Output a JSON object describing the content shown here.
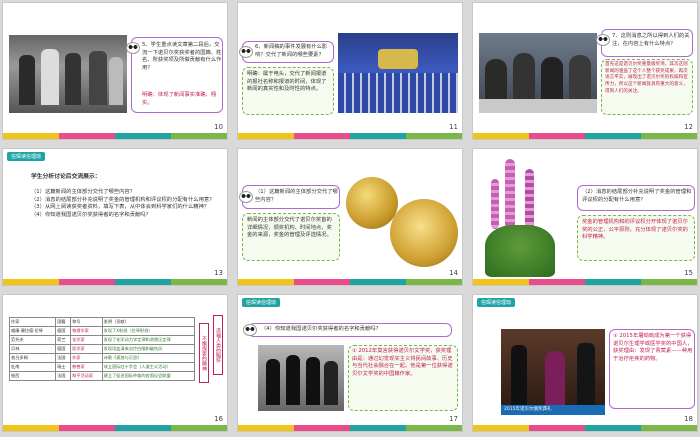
{
  "slides": [
    {
      "num": "10",
      "q": "5、学生重点读文章第二段后，交流一下诺贝尔奖获奖者的国籍、姓名、所获奖项及所做贡献有什么作用？",
      "a": "明确：体现了新闻事实准确、翔实。"
    },
    {
      "num": "11",
      "q": "6、新闻稿的事件发展有什么影响？交代了新闻的哪些要素？",
      "a": "明确：属于电头，交代了新闻报道的报社名称和报道的时间，体现了新闻的真实性和及时性的特点。"
    },
    {
      "num": "12",
      "q": "7、这则消息之所以得到人们的关注，在内容上有什么特点？",
      "a": "首先这是诺贝尔奖重量级奖项，其次这则新闻的涵盖了这个人整个获奖成果，再次语言平实，展现出了诺贝尔奖的权威和宣传力，所以这个新闻就具有重大的意义，得到人们的关注。"
    },
    {
      "num": "13",
      "tag": "信琛读信理琼",
      "title": "学生分析讨论后交流展示：",
      "items": [
        "（1）这篇新闻的主体部分交代了哪些内容？",
        "（2）消息的结尾部分补充说明了奖金的管理机构和评议权的分配有什么用意？",
        "（3）从网上阅读获奖者资料，填写下表，从中体会到科学家们的什么精神？",
        "（4）你知道我国诺贝尔奖获得者的名字和贡献吗？"
      ]
    },
    {
      "num": "14",
      "q": "（1）这篇新闻的主体部分交代了哪些内容？",
      "a": "新闻的主体部分交代了诺贝尔奖首的详细情况，颁奖机构、时间地点，奖金的来源，奖金的管理及评选情况。"
    },
    {
      "num": "15",
      "q": "（2）消息的结尾部分补充说明了奖金的管理和评议权的分配有什么用意？",
      "a": "奖金的管理机构和的评议权分开体现了诺贝尔奖的公正、公平原则，充分体现了诺贝尔奖的科学精神。"
    },
    {
      "num": "16",
      "table": {
        "headers": [
          "作家",
          "国籍",
          "称号",
          "发明（贡献）"
        ],
        "rows": [
          [
            "威廉·康拉德·伦琴",
            "德国",
            "物理学家",
            "发现了X射线（伦琴射线）"
          ],
          [
            "范托夫",
            "荷兰",
            "化学家",
            "发现了化学动力学定律和渗透压定律"
          ],
          [
            "贝林",
            "德国",
            "医学家",
            "发现用血清来治疗白喉和破伤风"
          ],
          [
            "普吕多姆",
            "法国",
            "作家",
            "诗歌《孤独与沉思》"
          ],
          [
            "杜南",
            "瑞士",
            "慈善家",
            "成立国际红十字会（人道主义活动）"
          ],
          [
            "帕西",
            "法国",
            "和平活动家",
            "建立了促进国际仲裁的各国议会联盟"
          ]
        ],
        "side1": "不懈探索的精神",
        "side2": "造福人类的胸怀"
      }
    },
    {
      "num": "17",
      "tag": "信琛读信理琼",
      "q": "（4）你知道我国诺贝尔奖获得者的名字和贡献吗？",
      "a": "① 2012年莫言获得诺贝尔文学奖，获奖理由是：通过幻觉现实主义将民间故事、历史与当代社会融合在一起。他是第一位获得诺贝尔文学奖的中国籍作家。"
    },
    {
      "num": "18",
      "tag": "信琛读信理琼",
      "a": "② 2015年屠呦呦成为第一个获得诺贝尔生理学或医学奖的中国人，获奖理由：发现了青蒿素——种用于治疗疟疾的药物。",
      "caption": "2015年诺贝尔颁奖典礼"
    }
  ]
}
